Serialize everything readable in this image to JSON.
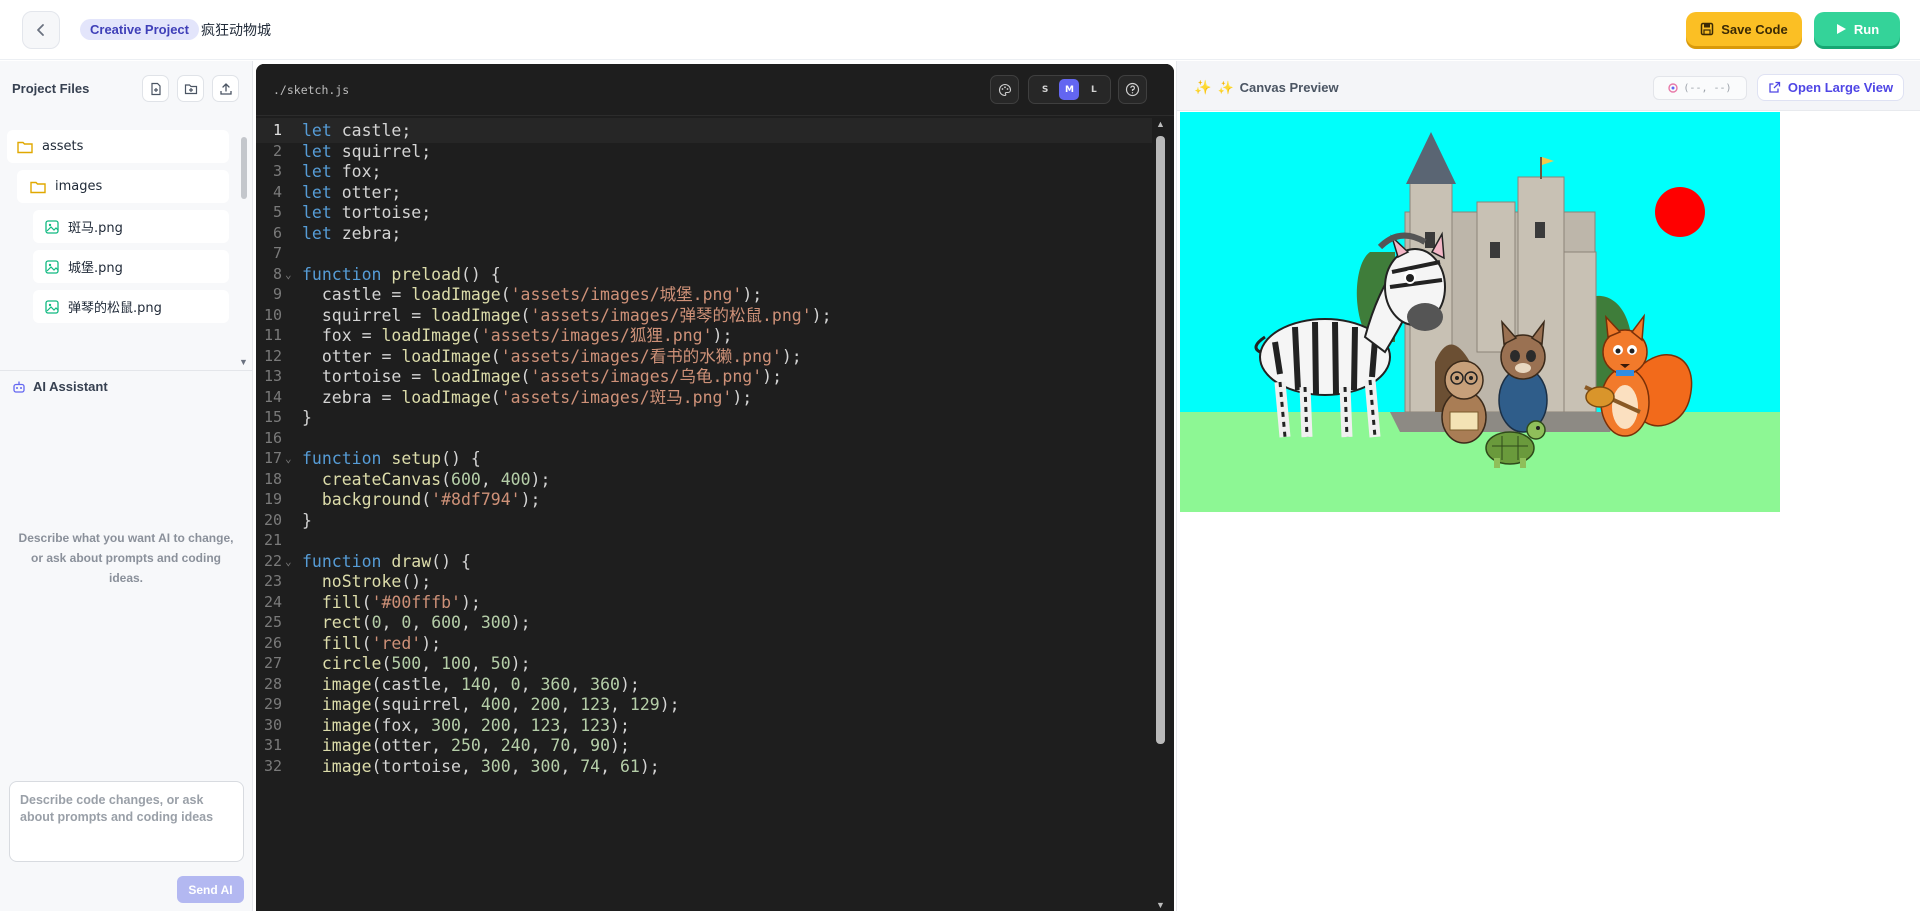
{
  "header": {
    "badge": "Creative Project",
    "project_name": "疯狂动物城",
    "save_label": "Save Code",
    "run_label": "Run"
  },
  "files": {
    "title": "Project Files",
    "tree": [
      {
        "label": "assets",
        "type": "folder"
      },
      {
        "label": "images",
        "type": "folder"
      },
      {
        "label": "斑马.png",
        "type": "image"
      },
      {
        "label": "城堡.png",
        "type": "image"
      },
      {
        "label": "弹琴的松鼠.png",
        "type": "image"
      }
    ]
  },
  "ai": {
    "title": "AI Assistant",
    "hint": "Describe what you want AI to change, or ask about prompts and coding ideas.",
    "input_placeholder": "Describe code changes, or ask about prompts and coding ideas",
    "send_label": "Send AI"
  },
  "editor": {
    "file_path": "./sketch.js",
    "sizes": [
      "S",
      "M",
      "L"
    ],
    "active_size": "M",
    "current_line": 1,
    "lines": [
      "let castle;",
      "let squirrel;",
      "let fox;",
      "let otter;",
      "let tortoise;",
      "let zebra;",
      "",
      "function preload() {",
      "  castle = loadImage('assets/images/城堡.png');",
      "  squirrel = loadImage('assets/images/弹琴的松鼠.png');",
      "  fox = loadImage('assets/images/狐狸.png');",
      "  otter = loadImage('assets/images/看书的水獭.png');",
      "  tortoise = loadImage('assets/images/乌龟.png');",
      "  zebra = loadImage('assets/images/斑马.png');",
      "}",
      "",
      "function setup() {",
      "  createCanvas(600, 400);",
      "  background('#8df794');",
      "}",
      "",
      "function draw() {",
      "  noStroke();",
      "  fill('#00fffb');",
      "  rect(0, 0, 600, 300);",
      "  fill('red');",
      "  circle(500, 100, 50);",
      "  image(castle, 140, 0, 360, 360);",
      "  image(squirrel, 400, 200, 123, 129);",
      "  image(fox, 300, 200, 123, 123);",
      "  image(otter, 250, 240, 70, 90);",
      "  image(tortoise, 300, 300, 74, 61);"
    ],
    "fold_lines": [
      8,
      17,
      22
    ]
  },
  "preview": {
    "title": "Canvas Preview",
    "coords": "(--, --)",
    "large_view_label": "Open Large View",
    "canvas_bg": "#8df794",
    "sky": "#00fffb",
    "sun": "red"
  }
}
